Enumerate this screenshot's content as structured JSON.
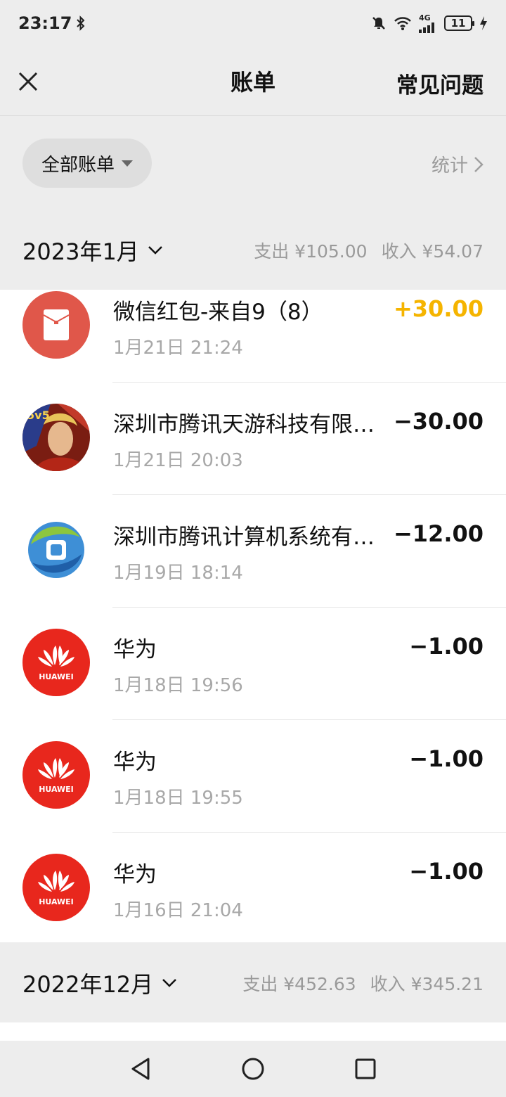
{
  "status_bar": {
    "time": "23:17",
    "network": "4G",
    "battery": "11",
    "icons": [
      "bluetooth-icon",
      "mute-icon",
      "wifi-icon",
      "signal-icon",
      "battery-icon",
      "charging-icon"
    ]
  },
  "header": {
    "title": "账单",
    "faq": "常见问题",
    "close_icon": "close-icon"
  },
  "filter": {
    "label": "全部账单",
    "stats": "统计"
  },
  "months": [
    {
      "label": "2023年1月",
      "expense": "支出 ¥105.00",
      "income": "收入 ¥54.07",
      "transactions": [
        {
          "title": "微信红包-来自9（8）",
          "time": "1月21日 21:24",
          "amount": "+30.00",
          "icon": "red-packet-icon"
        },
        {
          "title": "深圳市腾讯天游科技有限公司",
          "time": "1月21日 20:03",
          "amount": "−30.00",
          "icon": "game-avatar-icon"
        },
        {
          "title": "深圳市腾讯计算机系统有限公司",
          "time": "1月19日 18:14",
          "amount": "−12.00",
          "icon": "qq-browser-icon"
        },
        {
          "title": "华为",
          "time": "1月18日 19:56",
          "amount": "−1.00",
          "icon": "huawei-logo-icon"
        },
        {
          "title": "华为",
          "time": "1月18日 19:55",
          "amount": "−1.00",
          "icon": "huawei-logo-icon"
        },
        {
          "title": "华为",
          "time": "1月16日 21:04",
          "amount": "−1.00",
          "icon": "huawei-logo-icon"
        }
      ]
    },
    {
      "label": "2022年12月",
      "expense": "支出 ¥452.63",
      "income": "收入 ¥345.21"
    }
  ],
  "huawei_text": "HUAWEI",
  "colors": {
    "income": "#f5b400",
    "red_packet_bg": "#e0574a",
    "huawei_red": "#e8271d",
    "page_bg": "#ededed"
  }
}
